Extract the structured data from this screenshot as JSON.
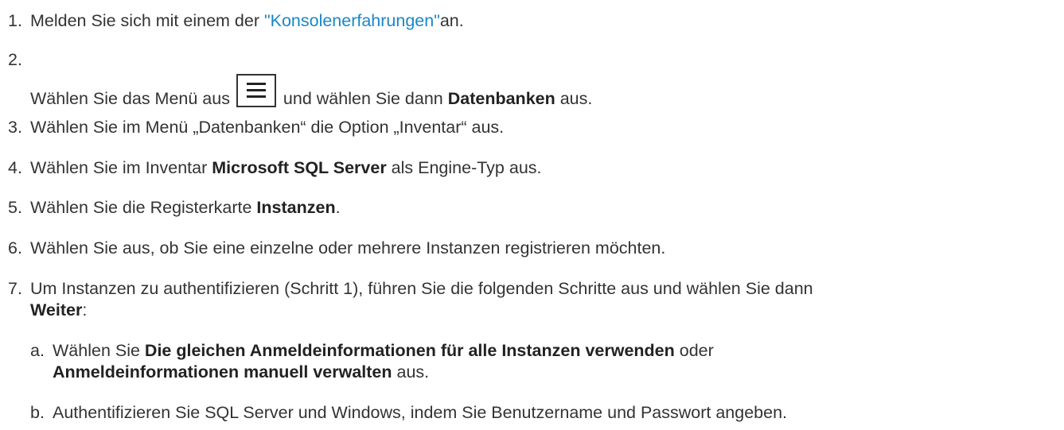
{
  "steps": {
    "s1": {
      "num": "1.",
      "text_a": "Melden Sie sich mit einem der ",
      "link": "\"Konsolenerfahrungen\"",
      "text_b": "an."
    },
    "s2": {
      "num": "2.",
      "text_a": "Wählen Sie das Menü aus ",
      "text_b": " und wählen Sie dann ",
      "bold": "Datenbanken",
      "text_c": " aus.",
      "icon": "hamburger-menu-icon"
    },
    "s3": {
      "num": "3.",
      "text": "Wählen Sie im Menü „Datenbanken“ die Option „Inventar“ aus."
    },
    "s4": {
      "num": "4.",
      "text_a": "Wählen Sie im Inventar ",
      "bold": "Microsoft SQL Server",
      "text_b": " als Engine-Typ aus."
    },
    "s5": {
      "num": "5.",
      "text_a": "Wählen Sie die Registerkarte ",
      "bold": "Instanzen",
      "text_b": "."
    },
    "s6": {
      "num": "6.",
      "text": "Wählen Sie aus, ob Sie eine einzelne oder mehrere Instanzen registrieren möchten."
    },
    "s7": {
      "num": "7.",
      "text_a": "Um Instanzen zu authentifizieren (Schritt 1), führen Sie die folgenden Schritte aus und wählen Sie dann",
      "bold": "Weiter",
      "text_b": ":"
    }
  },
  "substeps": {
    "a": {
      "num": "a.",
      "text_a": "Wählen Sie ",
      "bold_a": "Die gleichen Anmeldeinformationen für alle Instanzen verwenden",
      "text_b": " oder",
      "bold_b": "Anmeldeinformationen manuell verwalten",
      "text_c": " aus."
    },
    "b": {
      "num": "b.",
      "text": "Authentifizieren Sie SQL Server und Windows, indem Sie Benutzername und Passwort angeben."
    }
  }
}
